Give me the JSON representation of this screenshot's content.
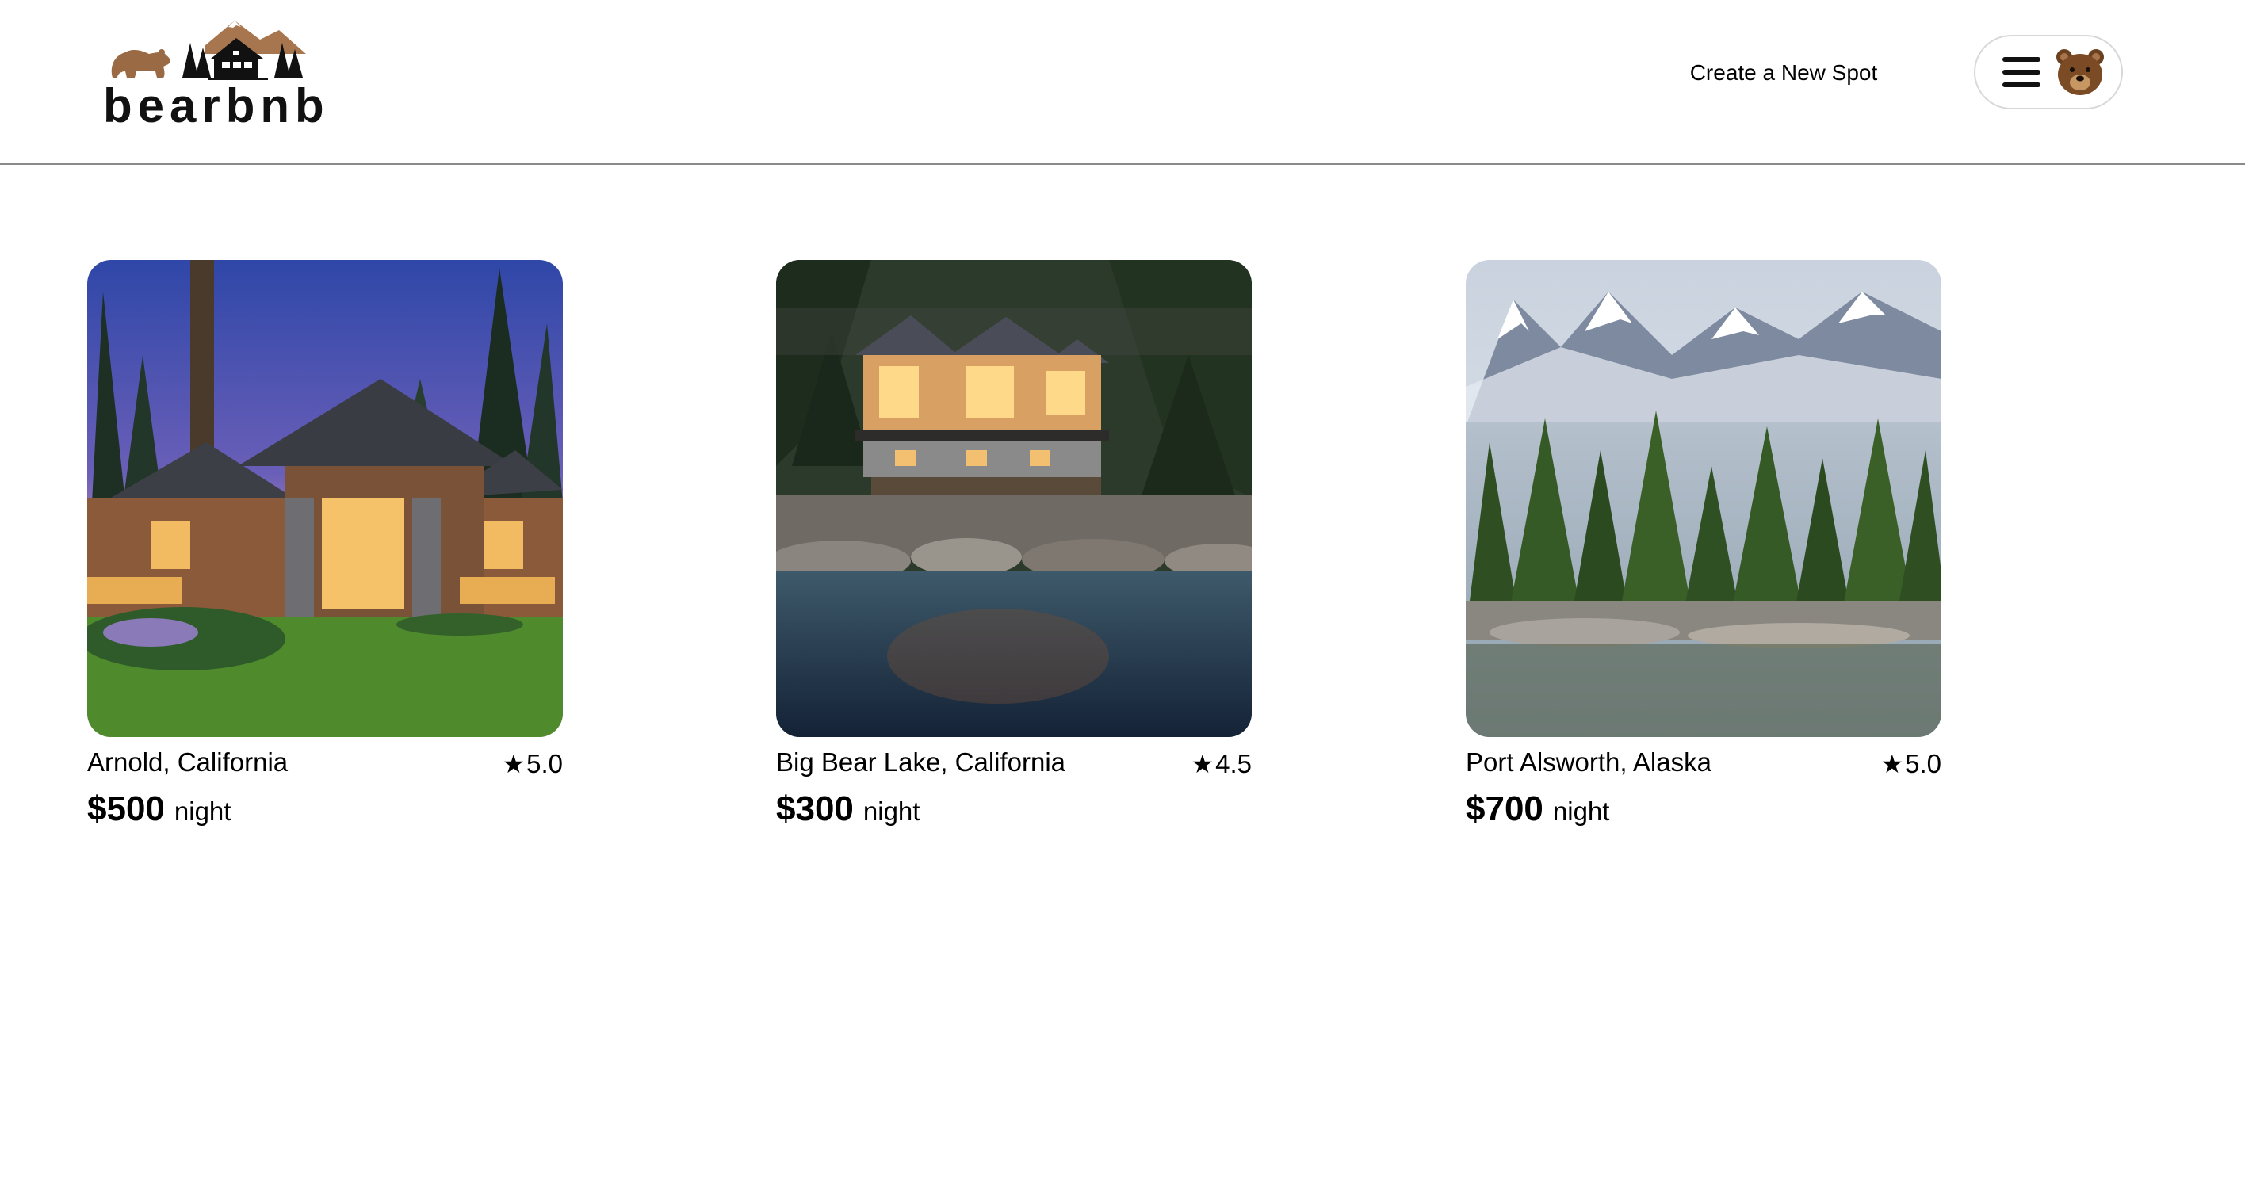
{
  "header": {
    "logo_text": "bearbnb",
    "create_spot_label": "Create a New Spot"
  },
  "icons": {
    "logo": "bear-cabin-mountain-logo",
    "menu": "hamburger-menu-icon",
    "avatar": "bear-face-avatar",
    "rating": "star-icon"
  },
  "colors": {
    "text": "#000000",
    "divider": "#8a8a8a",
    "pill_border": "#d8d8d8",
    "brand_brown": "#a0683c"
  },
  "spots": [
    {
      "location": "Arnold, California",
      "star": "★",
      "rating": "5.0",
      "price": "$500",
      "unit": "night",
      "image": "lodge-with-lawn-at-dusk"
    },
    {
      "location": "Big Bear Lake, California",
      "star": "★",
      "rating": "4.5",
      "price": "$300",
      "unit": "night",
      "image": "lakeside-house-over-rocks-at-night"
    },
    {
      "location": "Port Alsworth, Alaska",
      "star": "★",
      "rating": "5.0",
      "price": "$700",
      "unit": "night",
      "image": "lake-forest-snowy-mountains"
    }
  ]
}
